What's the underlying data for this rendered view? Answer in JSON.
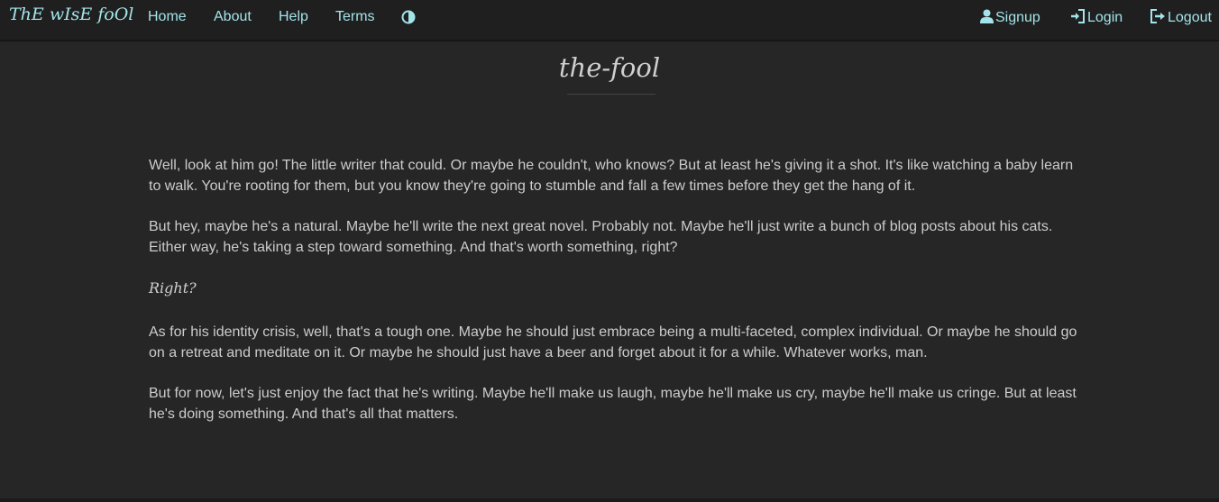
{
  "nav": {
    "brand": "ThE wIsE foOl",
    "links": [
      "Home",
      "About",
      "Help",
      "Terms"
    ],
    "theme_toggle_icon": "half-circle-icon",
    "signup_label": "Signup",
    "login_label": "Login",
    "logout_label": "Logout",
    "link_color": "#a3e4ea"
  },
  "page": {
    "title": "the-fool"
  },
  "content": {
    "p1": "Well, look at him go! The little writer that could. Or maybe he couldn't, who knows? But at least he's giving it a shot. It's like watching a baby learn to walk. You're rooting for them, but you know they're going to stumble and fall a few times before they get the hang of it.",
    "p2": "But hey, maybe he's a natural. Maybe he'll write the next great novel. Probably not. Maybe he'll just write a bunch of blog posts about his cats. Either way, he's taking a step toward something. And that's worth something, right?",
    "aside": "Right?",
    "p3": "As for his identity crisis, well, that's a tough one. Maybe he should just embrace being a multi-faceted, complex individual. Or maybe he should go on a retreat and meditate on it. Or maybe he should just have a beer and forget about it for a while. Whatever works, man.",
    "p4": "But for now, let's just enjoy the fact that he's writing. Maybe he'll make us laugh, maybe he'll make us cry, maybe he'll make us cringe. But at least he's doing something. And that's all that matters."
  }
}
